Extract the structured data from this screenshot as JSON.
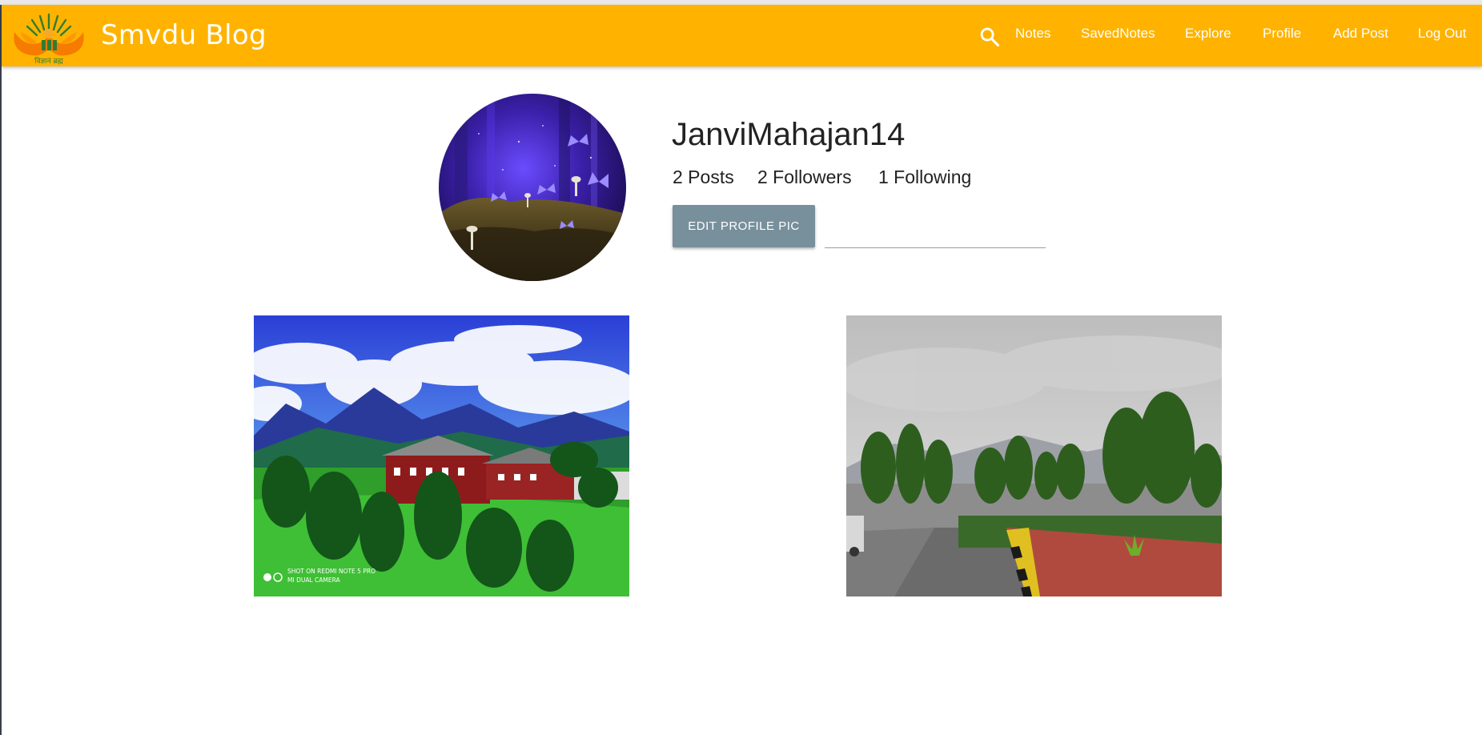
{
  "app": {
    "brand": "Smvdu Blog",
    "logo_caption": "विज्ञानं ब्रह्म"
  },
  "nav": {
    "items": [
      "Notes",
      "SavedNotes",
      "Explore",
      "Profile",
      "Add Post",
      "Log Out"
    ]
  },
  "profile": {
    "username": "JanviMahajan14",
    "posts": "2 Posts",
    "followers": "2 Followers",
    "following": "1 Following",
    "edit_button": "EDIT PROFILE PIC",
    "upload_value": ""
  },
  "posts": [
    {
      "watermark_line1": "SHOT ON REDMI NOTE 5 PRO",
      "watermark_line2": "MI DUAL CAMERA"
    },
    {
      "watermark_line1": "",
      "watermark_line2": ""
    }
  ],
  "colors": {
    "navbar": "#ffb300",
    "button": "#78909c",
    "text": "#222222"
  },
  "icons": {
    "search": "search-icon"
  }
}
